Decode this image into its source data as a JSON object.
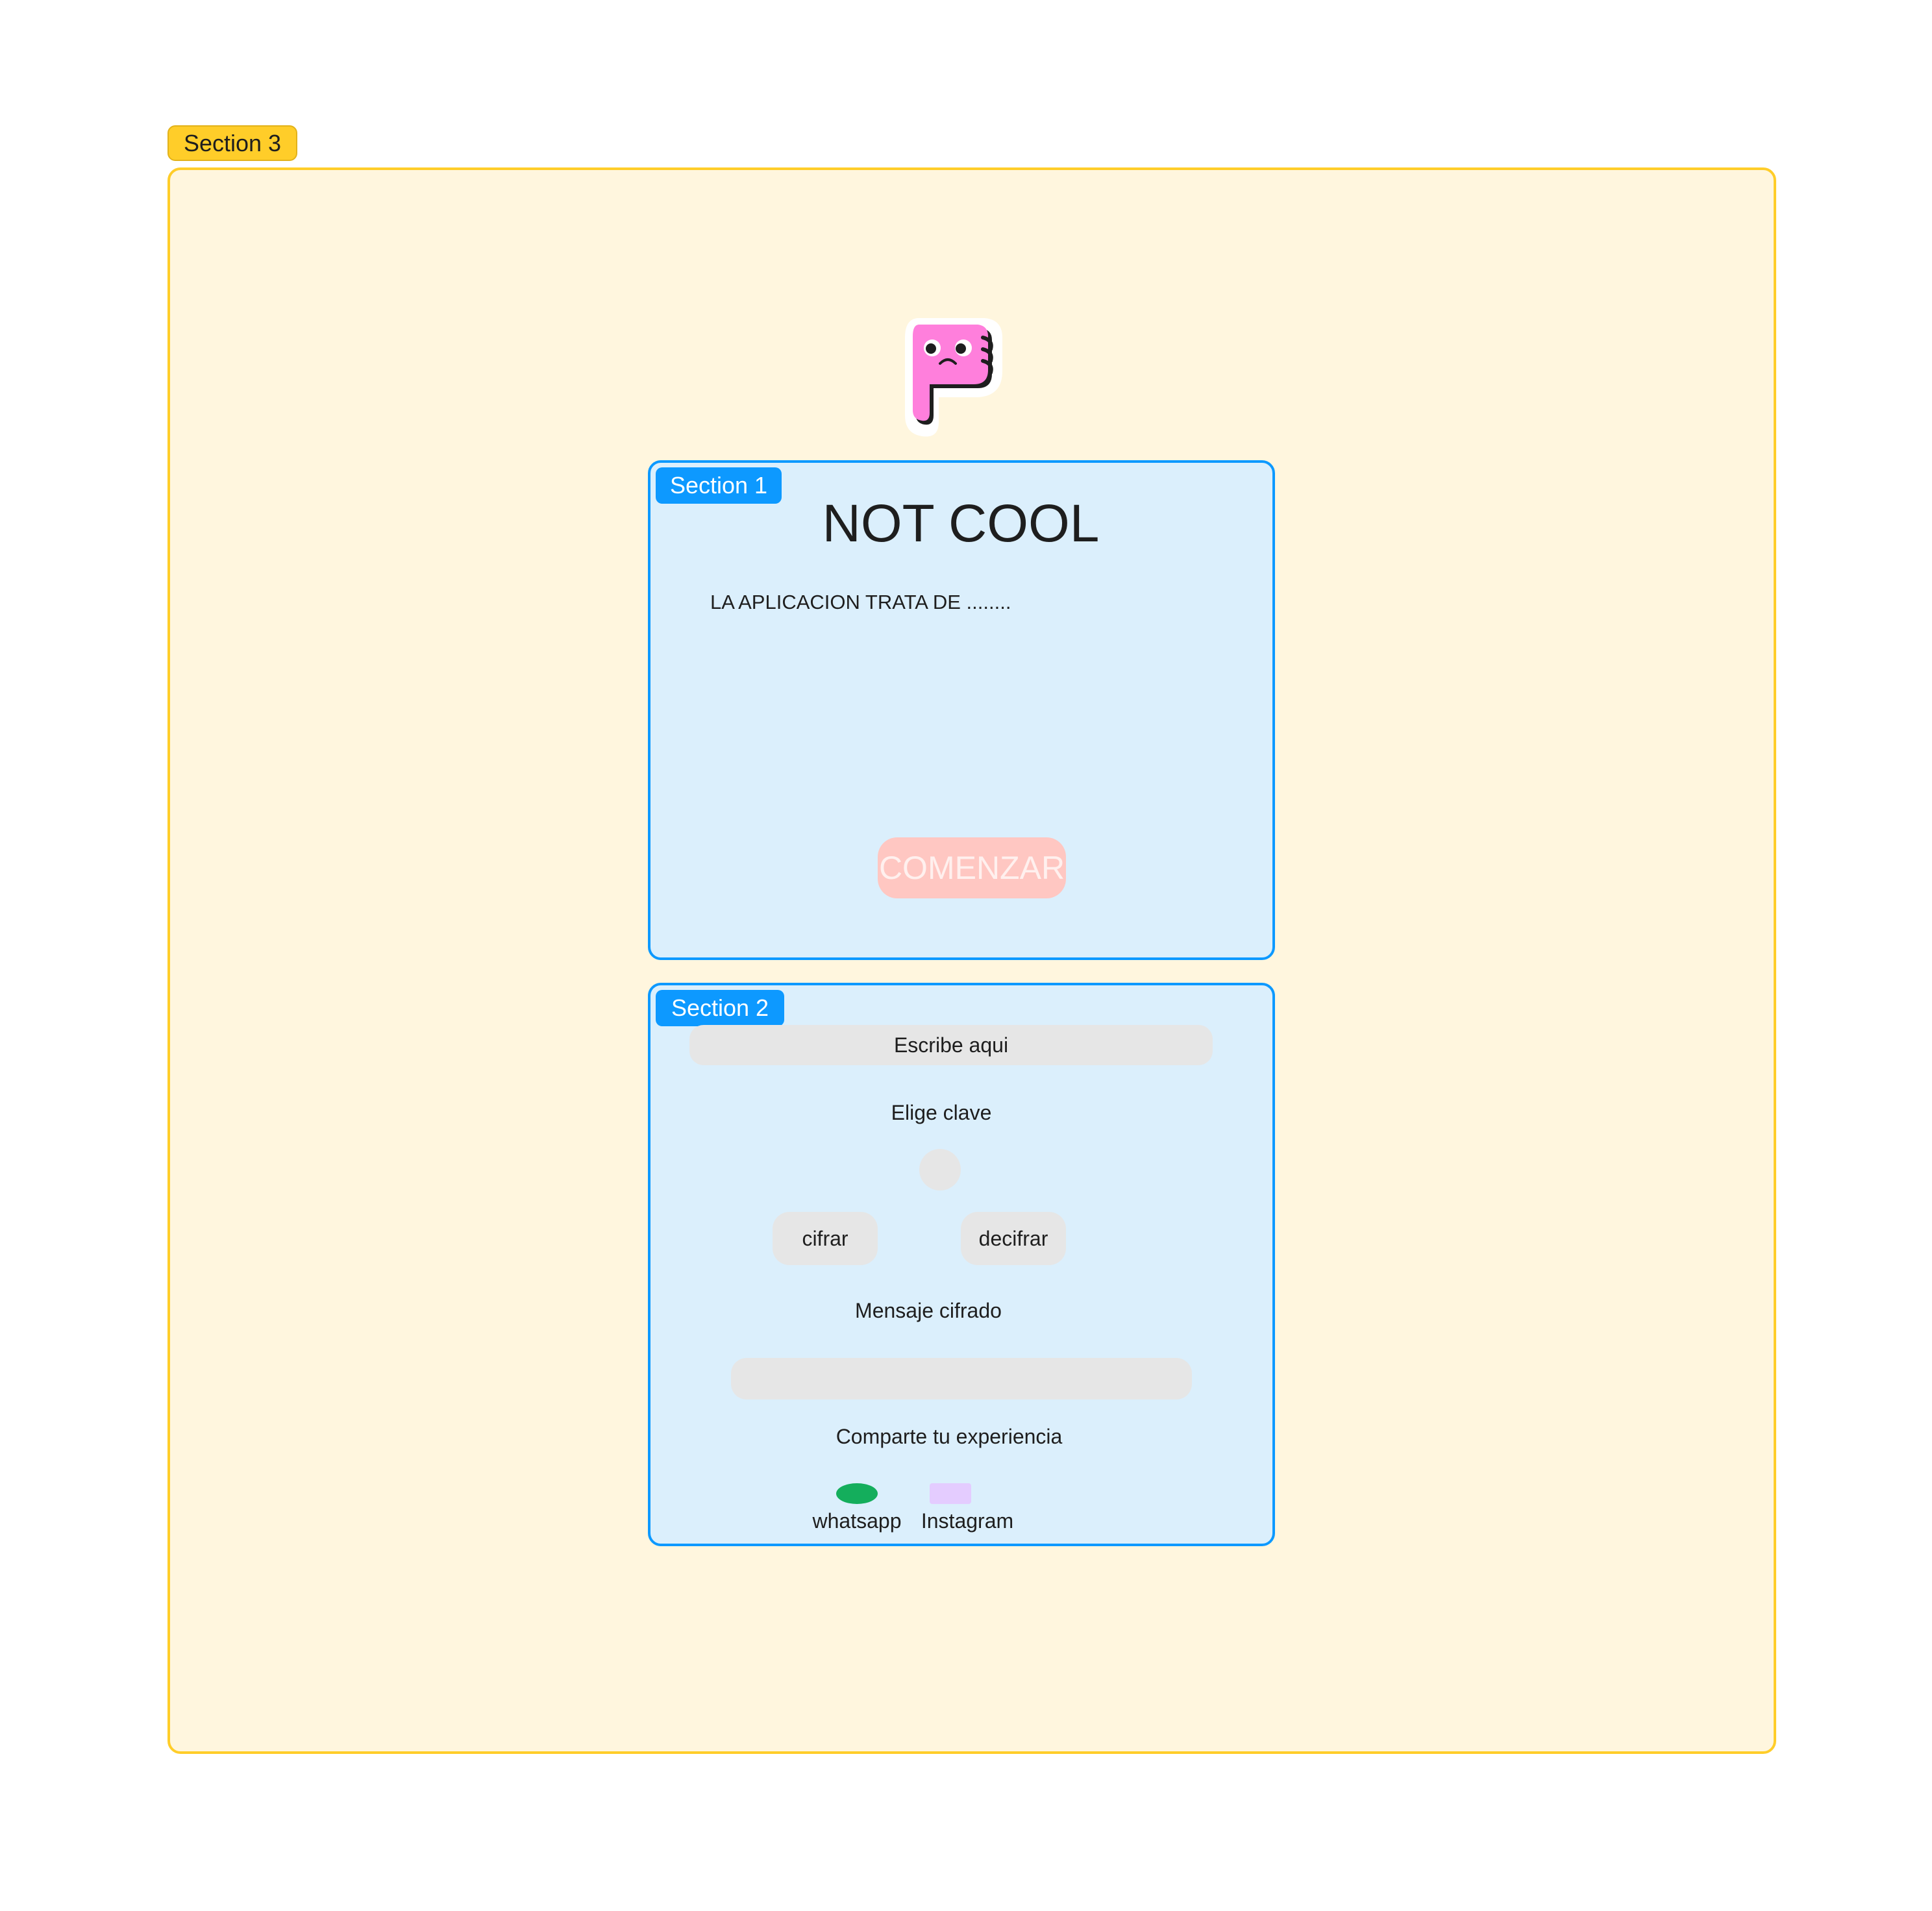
{
  "sections": {
    "outer_label": "Section 3",
    "intro_label": "Section 1",
    "tool_label": "Section 2"
  },
  "sticker": {
    "icon": "thumbs-down-sticker-icon",
    "color": "#ff7fdc"
  },
  "intro": {
    "title": "NOT COOL",
    "description": "LA APLICACION TRATA DE ........",
    "start_button": "COMENZAR"
  },
  "tool": {
    "input_placeholder": "Escribe aqui",
    "key_label": "Elige clave",
    "cipher_button": "cifrar",
    "decipher_button": "decifrar",
    "result_label": "Mensaje cifrado",
    "result_value": "",
    "share_label": "Comparte tu experiencia",
    "share_options": [
      {
        "label": "whatsapp",
        "icon": "whatsapp-icon",
        "color": "#14ae5c"
      },
      {
        "label": "Instagram",
        "icon": "instagram-icon",
        "color": "#e4ccff"
      }
    ]
  },
  "colors": {
    "section_yellow": "#ffcd29",
    "section_blue": "#0d99ff",
    "start_button_bg": "#ffc7c2"
  }
}
